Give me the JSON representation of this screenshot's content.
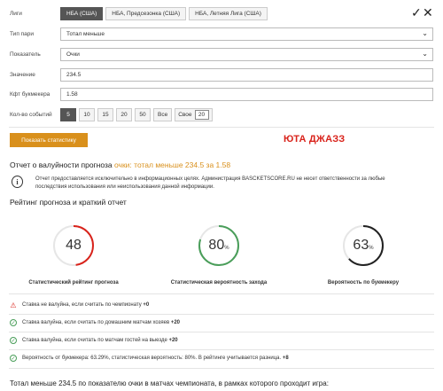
{
  "leagues": {
    "label": "Лиги",
    "tabs": [
      "НБА (США)",
      "НБА, Предсезонка (США)",
      "НБА, Летняя Лига (США)"
    ],
    "active": 0
  },
  "window": {
    "check_glyph": "✓",
    "close_glyph": "✕"
  },
  "form": {
    "bet_type_label": "Тип пари",
    "bet_type_value": "Тотал меньше",
    "indicator_label": "Показатель",
    "indicator_value": "Очки",
    "value_label": "Значение",
    "value_value": "234.5",
    "odds_label": "Кфт букмекера",
    "odds_value": "1.58",
    "events_label": "Кол-во событий",
    "events_options": [
      "5",
      "10",
      "15",
      "20",
      "50",
      "Все"
    ],
    "events_active": 0,
    "events_own_label": "Свое",
    "events_own_value": "20"
  },
  "show_stats_button": "Показать статистику",
  "team_title": "ЮТА ДЖАЗЗ",
  "report": {
    "title_prefix": "Отчет о валуйности прогноза",
    "title_highlight": "очки: тотал меньше 234.5 за 1.58",
    "disclaimer": "Отчет предоставляется исключительно в информационных целях. Администрация BASCKETSCORE.RU не несет ответственности за любые последствия использования или неиспользования данной информации."
  },
  "rating": {
    "title": "Рейтинг прогноза и краткий отчет",
    "gauges": [
      {
        "value": "48",
        "pct": "",
        "fraction": 0.48,
        "color": "#d9231b",
        "caption": "Статистический рейтинг прогноза"
      },
      {
        "value": "80",
        "pct": "%",
        "fraction": 0.8,
        "color": "#4a9e5a",
        "caption": "Статистическая вероятность захода"
      },
      {
        "value": "63",
        "pct": "%",
        "fraction": 0.63,
        "color": "#222222",
        "caption": "Вероятность по букмекеру"
      }
    ]
  },
  "checks": [
    {
      "type": "warn",
      "icon": "warning-icon",
      "text": "Ставка не валуйна, если считать по чемпионату",
      "score": "+0"
    },
    {
      "type": "ok",
      "icon": "check-circle-icon",
      "text": "Ставка валуйна, если считать по домашним матчам хозяев",
      "score": "+20"
    },
    {
      "type": "ok",
      "icon": "check-circle-icon",
      "text": "Ставка валуйна, если считать по матчам гостей на выезде",
      "score": "+20"
    },
    {
      "type": "ok",
      "icon": "check-circle-icon",
      "text": "Вероятность от букмекера: 63.29%, статистическая вероятность: 80%. В рейтинге учитывается разница.",
      "score": "+8"
    }
  ],
  "bottom_text": "Тотал меньше 234.5 по показателю очки в матчах чемпионата, в рамках которого проходит игра:"
}
